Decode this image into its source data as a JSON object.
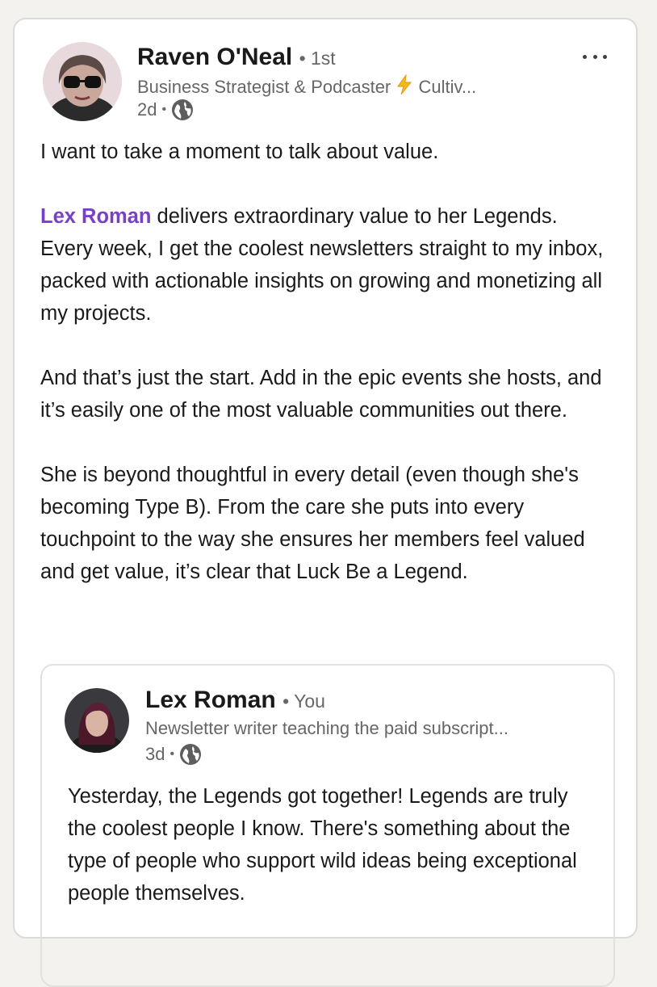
{
  "post": {
    "author": {
      "name": "Raven O'Neal",
      "degree": "• 1st",
      "headline_part1": "Business Strategist & Podcaster",
      "headline_icon": "lightning-icon",
      "headline_part2": "Cultiv...",
      "time": "2d",
      "separator": "•",
      "visibility_icon": "globe-icon"
    },
    "more_icon": "ellipsis-icon",
    "paragraph1": "I want to take a moment to talk about value.",
    "mention": "Lex Roman",
    "paragraph2_rest": " delivers extraordinary value to her Legends. Every week, I get the coolest newsletters straight to my inbox, packed with actionable insights on growing and monetizing all my projects.",
    "paragraph3": "And that’s just the start. Add in the epic events she hosts, and it’s easily one of the most valuable communities out there.",
    "paragraph4": "She is beyond thoughtful in every detail (even though she's becoming Type B). From the care she puts into every touchpoint to the way she ensures her members feel valued and get value, it’s clear that Luck Be a Legend."
  },
  "quoted_post": {
    "author": {
      "name": "Lex Roman",
      "relation": "• You",
      "headline": "Newsletter writer teaching the paid subscript...",
      "time": "3d",
      "separator": "•",
      "visibility_icon": "globe-icon"
    },
    "text": "Yesterday, the Legends got together! Legends are truly the coolest people I know. There's something about the type of people who support wild ideas being exceptional people themselves."
  },
  "colors": {
    "mention": "#7a3fc9",
    "lightning": "#f5b91a",
    "secondary_text": "#666666",
    "background": "#f3f2ef"
  }
}
